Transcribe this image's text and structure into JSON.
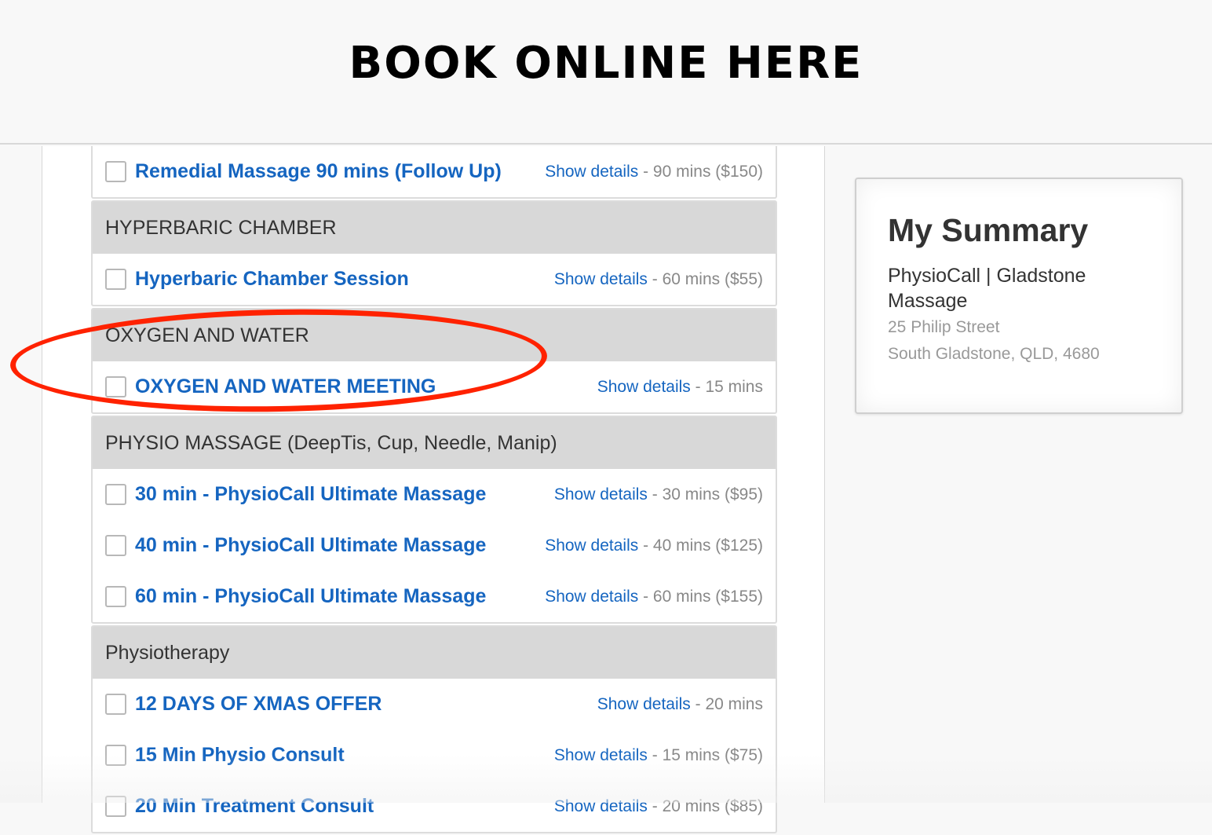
{
  "header": {
    "title": "BOOK ONLINE HERE"
  },
  "colors": {
    "link": "#1565c0",
    "highlight": "#ff2200",
    "group_bg": "#d8d8d8"
  },
  "icons": {
    "checkbox": "checkbox-icon"
  },
  "groups": [
    {
      "title": "",
      "items": [
        {
          "name": "Remedial Massage 90 mins (Follow Up)",
          "details": "Show details",
          "meta": " - 90 mins ($150)"
        }
      ]
    },
    {
      "title": "HYPERBARIC CHAMBER",
      "items": [
        {
          "name": "Hyperbaric Chamber Session",
          "details": "Show details",
          "meta": " - 60 mins ($55)"
        }
      ]
    },
    {
      "title": "OXYGEN AND WATER",
      "items": [
        {
          "name": "OXYGEN AND WATER MEETING",
          "details": "Show details",
          "meta": " - 15 mins"
        }
      ]
    },
    {
      "title": "PHYSIO MASSAGE (DeepTis, Cup, Needle, Manip)",
      "items": [
        {
          "name": "30 min - PhysioCall Ultimate Massage",
          "details": "Show details",
          "meta": " - 30 mins ($95)"
        },
        {
          "name": "40 min - PhysioCall Ultimate Massage",
          "details": "Show details",
          "meta": " - 40 mins ($125)"
        },
        {
          "name": "60 min - PhysioCall Ultimate Massage",
          "details": "Show details",
          "meta": " - 60 mins ($155)"
        }
      ]
    },
    {
      "title": "Physiotherapy",
      "items": [
        {
          "name": "12 DAYS OF XMAS OFFER",
          "details": "Show details",
          "meta": " - 20 mins"
        },
        {
          "name": "15 Min Physio Consult",
          "details": "Show details",
          "meta": " - 15 mins ($75)"
        },
        {
          "name": "20 Min Treatment Consult",
          "details": "Show details",
          "meta": " - 20 mins ($85)"
        }
      ]
    }
  ],
  "summary": {
    "title": "My Summary",
    "business": "PhysioCall | Gladstone Massage",
    "address_line1": "25 Philip Street",
    "address_line2": "South Gladstone, QLD, 4680"
  }
}
